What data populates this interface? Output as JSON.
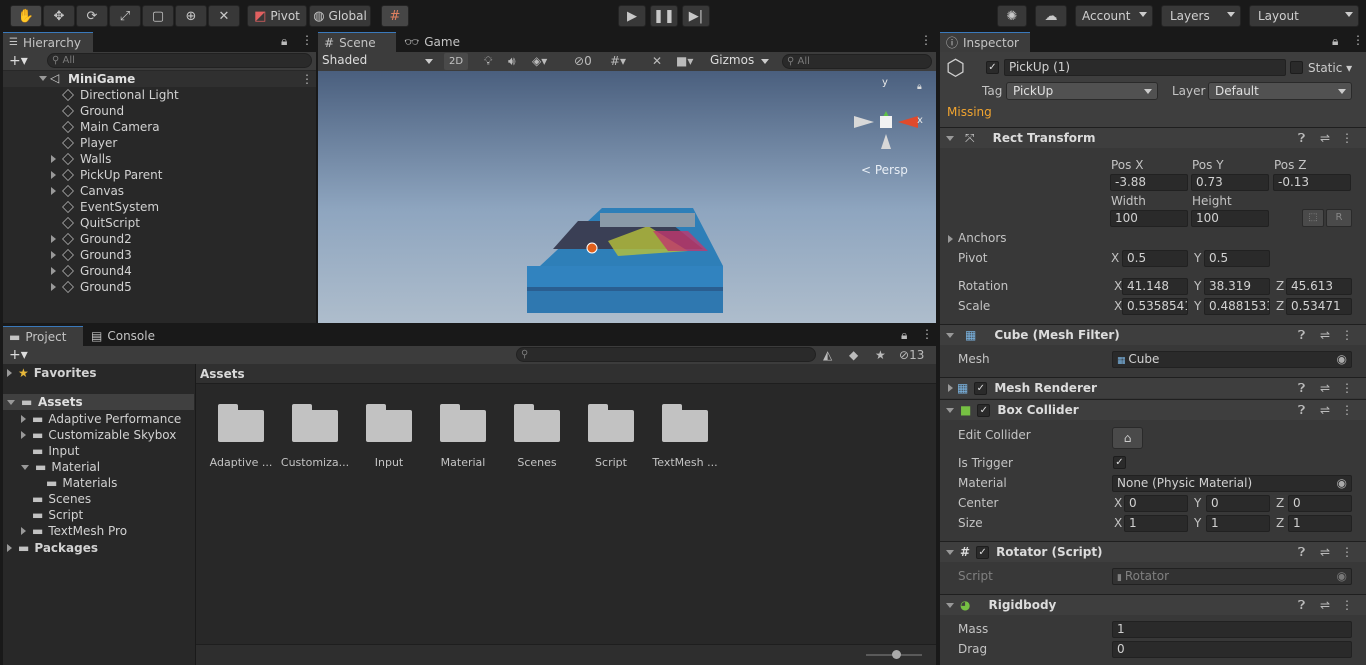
{
  "toolbar": {
    "pivot_label": "Pivot",
    "global_label": "Global",
    "account_label": "Account",
    "layers_label": "Layers",
    "layout_label": "Layout"
  },
  "hierarchy": {
    "tab_label": "Hierarchy",
    "search_placeholder": "All",
    "scene_name": "MiniGame",
    "items": [
      {
        "label": "Directional Light",
        "expandable": false
      },
      {
        "label": "Ground",
        "expandable": false
      },
      {
        "label": "Main Camera",
        "expandable": false
      },
      {
        "label": "Player",
        "expandable": false
      },
      {
        "label": "Walls",
        "expandable": true
      },
      {
        "label": "PickUp Parent",
        "expandable": true
      },
      {
        "label": "Canvas",
        "expandable": true
      },
      {
        "label": "EventSystem",
        "expandable": false
      },
      {
        "label": "QuitScript",
        "expandable": false
      },
      {
        "label": "Ground2",
        "expandable": true
      },
      {
        "label": "Ground3",
        "expandable": true
      },
      {
        "label": "Ground4",
        "expandable": true
      },
      {
        "label": "Ground5",
        "expandable": true
      }
    ]
  },
  "scene": {
    "tab_scene": "Scene",
    "tab_game": "Game",
    "shading_mode": "Shaded",
    "mode_2d": "2D",
    "hidden_count": "0",
    "gizmos_label": "Gizmos",
    "search_placeholder": "All",
    "persp_label": "< Persp",
    "axis_y": "y",
    "axis_x": "x"
  },
  "project": {
    "tab_project": "Project",
    "tab_console": "Console",
    "hidden_count": "13",
    "favorites_label": "Favorites",
    "assets_label": "Assets",
    "packages_label": "Packages",
    "tree": [
      {
        "label": "Adaptive Performance",
        "indent": 1,
        "expandable": true,
        "open": false
      },
      {
        "label": "Customizable Skybox",
        "indent": 1,
        "expandable": true,
        "open": false
      },
      {
        "label": "Input",
        "indent": 1,
        "expandable": false,
        "open": false
      },
      {
        "label": "Material",
        "indent": 1,
        "expandable": true,
        "open": true
      },
      {
        "label": "Materials",
        "indent": 2,
        "expandable": false,
        "open": false
      },
      {
        "label": "Scenes",
        "indent": 1,
        "expandable": false,
        "open": false
      },
      {
        "label": "Script",
        "indent": 1,
        "expandable": false,
        "open": false
      },
      {
        "label": "TextMesh Pro",
        "indent": 1,
        "expandable": true,
        "open": false
      }
    ],
    "breadcrumb": "Assets",
    "folders": [
      "Adaptive ...",
      "Customiza...",
      "Input",
      "Material",
      "Scenes",
      "Script",
      "TextMesh ..."
    ]
  },
  "inspector": {
    "tab_label": "Inspector",
    "object_name": "PickUp (1)",
    "static_label": "Static",
    "tag_label": "Tag",
    "tag_value": "PickUp",
    "layer_label": "Layer",
    "layer_value": "Default",
    "missing_label": "Missing",
    "rect_transform": {
      "title": "Rect Transform",
      "posx_label": "Pos X",
      "posy_label": "Pos Y",
      "posz_label": "Pos Z",
      "posx": "-3.88",
      "posy": "0.73",
      "posz": "-0.13",
      "width_label": "Width",
      "height_label": "Height",
      "width": "100",
      "height": "100",
      "r_button": "R",
      "anchors_label": "Anchors",
      "pivot_label": "Pivot",
      "pivot_x": "0.5",
      "pivot_y": "0.5",
      "rotation_label": "Rotation",
      "rot_x": "41.148",
      "rot_y": "38.319",
      "rot_z": "45.613",
      "scale_label": "Scale",
      "scale_x": "0.5358541",
      "scale_y": "0.4881533",
      "scale_z": "0.53471"
    },
    "mesh_filter": {
      "title": "Cube (Mesh Filter)",
      "mesh_label": "Mesh",
      "mesh_value": "Cube"
    },
    "mesh_renderer": {
      "title": "Mesh Renderer"
    },
    "box_collider": {
      "title": "Box Collider",
      "edit_label": "Edit Collider",
      "trigger_label": "Is Trigger",
      "material_label": "Material",
      "material_value": "None (Physic Material)",
      "center_label": "Center",
      "center_x": "0",
      "center_y": "0",
      "center_z": "0",
      "size_label": "Size",
      "size_x": "1",
      "size_y": "1",
      "size_z": "1"
    },
    "rotator": {
      "title": "Rotator (Script)",
      "script_label": "Script",
      "script_value": "Rotator"
    },
    "rigidbody": {
      "title": "Rigidbody",
      "mass_label": "Mass",
      "mass": "1",
      "drag_label": "Drag",
      "drag": "0"
    },
    "axis": {
      "x": "X",
      "y": "Y",
      "z": "Z"
    }
  }
}
